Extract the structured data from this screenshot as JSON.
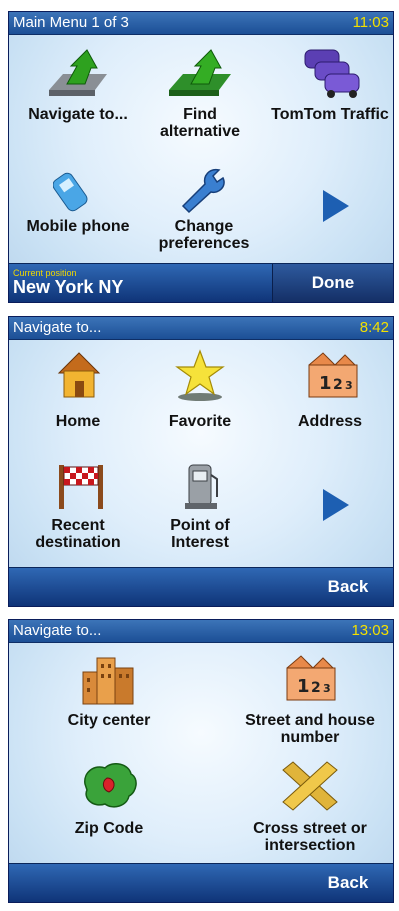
{
  "screens": [
    {
      "title": "Main Menu 1  of 3",
      "time": "11:03",
      "tiles": [
        {
          "label": "Navigate to...",
          "icon": "navigate-arrow-icon"
        },
        {
          "label": "Find alternative",
          "icon": "find-alternative-icon"
        },
        {
          "label": "TomTom Traffic",
          "icon": "traffic-cars-icon"
        },
        {
          "label": "Mobile phone",
          "icon": "mobile-phone-icon"
        },
        {
          "label": "Change preferences",
          "icon": "wrench-icon"
        }
      ],
      "next_icon": "next-page-arrow-icon",
      "current_position_caption": "Current position",
      "current_position_value": "New York NY",
      "done_label": "Done"
    },
    {
      "title": "Navigate to...",
      "time": "8:42",
      "tiles": [
        {
          "label": "Home",
          "icon": "home-icon"
        },
        {
          "label": "Favorite",
          "icon": "star-icon"
        },
        {
          "label": "Address",
          "icon": "address-house-icon"
        },
        {
          "label": "Recent destination",
          "icon": "finish-flag-icon"
        },
        {
          "label": "Point of Interest",
          "icon": "poi-pump-icon"
        }
      ],
      "next_icon": "next-page-arrow-icon",
      "back_label": "Back"
    },
    {
      "title": "Navigate to...",
      "time": "13:03",
      "tiles": [
        {
          "label": "City center",
          "icon": "city-buildings-icon"
        },
        {
          "label": "Street and house number",
          "icon": "street-house-icon"
        },
        {
          "label": "Zip Code",
          "icon": "zip-map-icon"
        },
        {
          "label": "Cross street or intersection",
          "icon": "intersection-icon"
        }
      ],
      "back_label": "Back"
    }
  ],
  "colors": {
    "title_bar": "#1c4f96",
    "clock": "#f3e000",
    "bottom_bar": "#0f3478",
    "arrow": "#1d5fb2"
  }
}
